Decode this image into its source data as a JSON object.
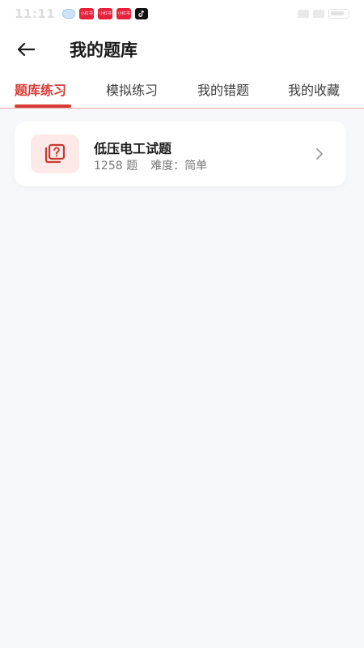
{
  "status_bar": {
    "time": "11:11",
    "badges": [
      "小红书",
      "小红书",
      "小红书"
    ]
  },
  "header": {
    "title": "我的题库",
    "back_icon": "arrow-left-icon"
  },
  "tabs": [
    {
      "label": "题库练习",
      "active": true
    },
    {
      "label": "模拟练习",
      "active": false
    },
    {
      "label": "我的错题",
      "active": false
    },
    {
      "label": "我的收藏",
      "active": false
    }
  ],
  "bank_list": [
    {
      "title": "低压电工试题",
      "count": "1258 题",
      "difficulty_label": "难度：",
      "difficulty": "简单",
      "icon": "question-cards-icon"
    }
  ],
  "colors": {
    "accent": "#d63b36",
    "icon_bg": "#fde9e7",
    "page_bg": "#f6f8fc"
  }
}
